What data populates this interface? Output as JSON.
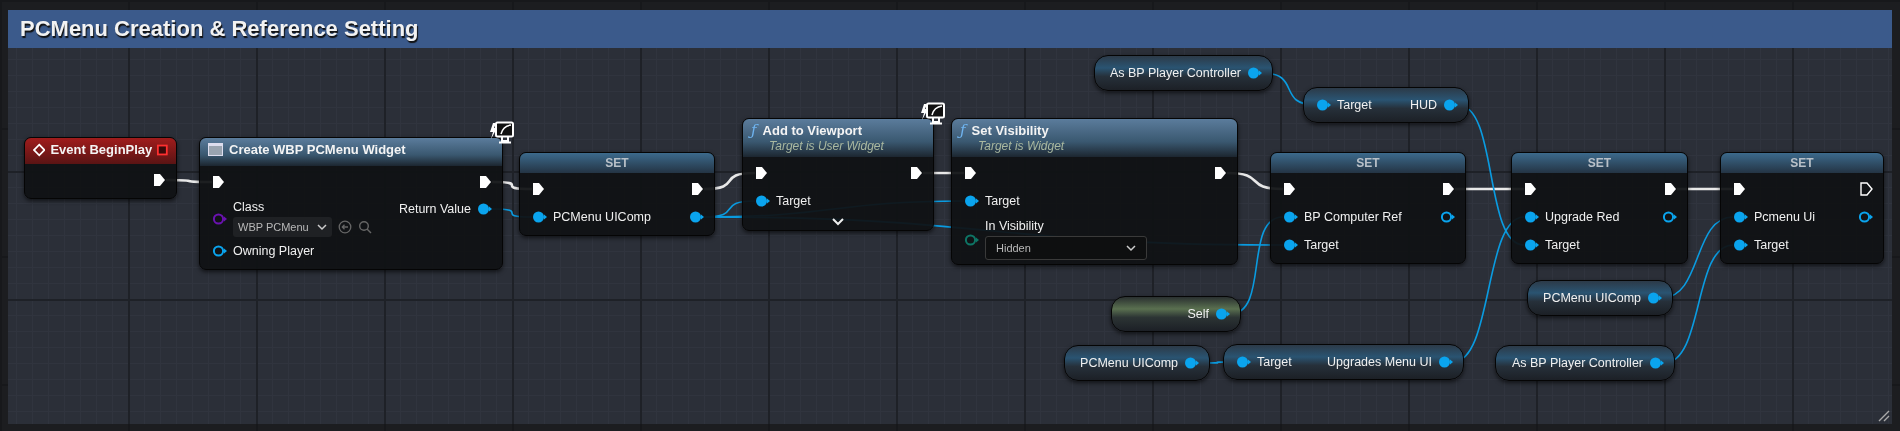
{
  "comment": {
    "title": "PCMenu Creation & Reference Setting"
  },
  "nodes": [
    {
      "kind": "event",
      "title": "Event BeginPlay",
      "rows": [
        {
          "right": {
            "kind": "exec",
            "connected": true
          }
        }
      ]
    },
    {
      "kind": "call",
      "title": "Create WBP PCMenu Widget",
      "widget_icon": true,
      "widget_badge": true,
      "rows": [
        {
          "left": {
            "kind": "exec",
            "connected": true
          },
          "right": {
            "kind": "exec",
            "connected": true
          }
        },
        {
          "left": {
            "kind": "class",
            "connected": false,
            "label": "Class",
            "value": "WBP PCMenu"
          },
          "right": {
            "kind": "object",
            "connected": true,
            "label": "Return Value"
          }
        },
        {
          "left": {
            "kind": "object",
            "connected": false,
            "label": "Owning Player"
          }
        }
      ]
    },
    {
      "kind": "set",
      "title": "SET",
      "rows": [
        {
          "left": {
            "kind": "exec",
            "connected": true
          },
          "right": {
            "kind": "exec",
            "connected": true
          }
        },
        {
          "left": {
            "kind": "object",
            "connected": true,
            "label": "PCMenu UIComp"
          },
          "right": {
            "kind": "object",
            "connected": true
          }
        }
      ]
    },
    {
      "kind": "call",
      "title": "Add to Viewport",
      "subtitle": "Target is User Widget",
      "glyph": "ƒ",
      "widget_badge": true,
      "advanced": true,
      "rows": [
        {
          "left": {
            "kind": "exec",
            "connected": true
          },
          "right": {
            "kind": "exec",
            "connected": true
          }
        },
        {
          "left": {
            "kind": "object",
            "connected": true,
            "label": "Target"
          }
        }
      ]
    },
    {
      "kind": "call",
      "title": "Set Visibility",
      "subtitle": "Target is Widget",
      "glyph": "ƒ",
      "rows": [
        {
          "left": {
            "kind": "exec",
            "connected": true
          },
          "right": {
            "kind": "exec",
            "connected": true
          }
        },
        {
          "left": {
            "kind": "object",
            "connected": true,
            "label": "Target"
          }
        },
        {
          "left": {
            "kind": "enum",
            "connected": false,
            "label": "In Visibility",
            "value": "Hidden"
          }
        }
      ]
    },
    {
      "kind": "pure",
      "rows": [
        {
          "right": {
            "kind": "object",
            "connected": true,
            "label": "As BP Player Controller"
          }
        }
      ]
    },
    {
      "kind": "pure",
      "rows": [
        {
          "left": {
            "kind": "object",
            "connected": true,
            "label": "Target"
          },
          "right": {
            "kind": "object",
            "connected": true,
            "label": "HUD"
          }
        }
      ]
    },
    {
      "kind": "set",
      "title": "SET",
      "rows": [
        {
          "left": {
            "kind": "exec",
            "connected": true
          },
          "right": {
            "kind": "exec",
            "connected": true
          }
        },
        {
          "left": {
            "kind": "object",
            "connected": true,
            "label": "BP Computer Ref"
          },
          "right": {
            "kind": "object",
            "connected": false
          }
        },
        {
          "left": {
            "kind": "object",
            "connected": true,
            "label": "Target"
          }
        }
      ]
    },
    {
      "kind": "set",
      "title": "SET",
      "rows": [
        {
          "left": {
            "kind": "exec",
            "connected": true
          },
          "right": {
            "kind": "exec",
            "connected": true
          }
        },
        {
          "left": {
            "kind": "object",
            "connected": true,
            "label": "Upgrade Red"
          },
          "right": {
            "kind": "object",
            "connected": false
          }
        },
        {
          "left": {
            "kind": "object",
            "connected": true,
            "label": "Target"
          }
        }
      ]
    },
    {
      "kind": "set",
      "title": "SET",
      "rows": [
        {
          "left": {
            "kind": "exec",
            "connected": true
          },
          "right": {
            "kind": "exec",
            "connected": false
          }
        },
        {
          "left": {
            "kind": "object",
            "connected": true,
            "label": "Pcmenu Ui"
          },
          "right": {
            "kind": "object",
            "connected": false
          }
        },
        {
          "left": {
            "kind": "object",
            "connected": true,
            "label": "Target"
          }
        }
      ]
    },
    {
      "kind": "self",
      "rows": [
        {
          "right": {
            "kind": "object",
            "connected": true,
            "label": "Self"
          }
        }
      ]
    },
    {
      "kind": "pure",
      "rows": [
        {
          "right": {
            "kind": "object",
            "connected": true,
            "label": "PCMenu UIComp"
          }
        }
      ]
    },
    {
      "kind": "pure",
      "rows": [
        {
          "left": {
            "kind": "object",
            "connected": true,
            "label": "Target"
          },
          "right": {
            "kind": "object",
            "connected": true,
            "label": "Upgrades Menu UI"
          }
        }
      ]
    },
    {
      "kind": "pure",
      "rows": [
        {
          "right": {
            "kind": "object",
            "connected": true,
            "label": "PCMenu UIComp"
          }
        }
      ]
    },
    {
      "kind": "pure",
      "rows": [
        {
          "right": {
            "kind": "object",
            "connected": true,
            "label": "As BP Player Controller"
          }
        }
      ]
    }
  ]
}
